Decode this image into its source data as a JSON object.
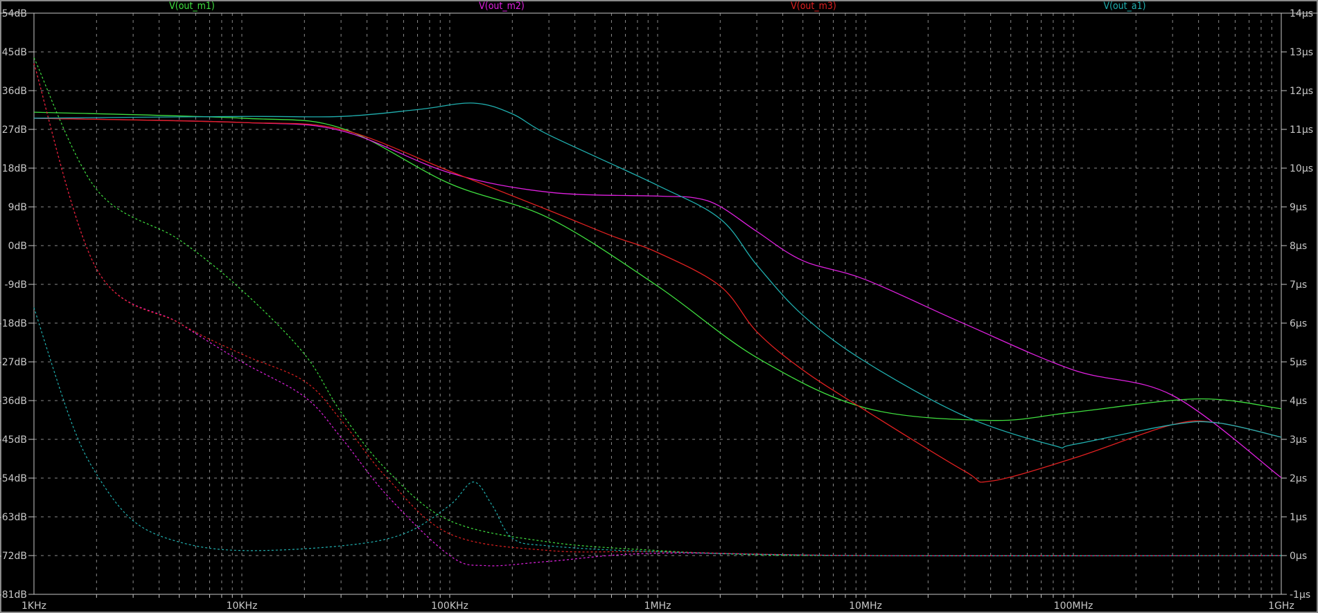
{
  "chart_data": {
    "type": "line",
    "title": "",
    "xscale": "log",
    "xlim": [
      1000,
      1000000000
    ],
    "x_ticks": [
      {
        "value": 1000,
        "label": "1KHz"
      },
      {
        "value": 10000,
        "label": "10KHz"
      },
      {
        "value": 100000,
        "label": "100KHz"
      },
      {
        "value": 1000000,
        "label": "1MHz"
      },
      {
        "value": 10000000,
        "label": "10MHz"
      },
      {
        "value": 100000000,
        "label": "100MHz"
      },
      {
        "value": 1000000000,
        "label": "1GHz"
      }
    ],
    "ylim_left": [
      -81,
      54
    ],
    "left_ticks": [
      "54dB",
      "45dB",
      "36dB",
      "27dB",
      "18dB",
      "9dB",
      "0dB",
      "-9dB",
      "-18dB",
      "-27dB",
      "-36dB",
      "-45dB",
      "-54dB",
      "-63dB",
      "-72dB",
      "-81dB"
    ],
    "ylim_right": [
      -1,
      14
    ],
    "right_ticks": [
      "14µs",
      "13µs",
      "12µs",
      "11µs",
      "10µs",
      "9µs",
      "8µs",
      "7µs",
      "6µs",
      "5µs",
      "4µs",
      "3µs",
      "2µs",
      "1µs",
      "0µs",
      "-1µs"
    ],
    "grid": true,
    "legend_placement": "top",
    "series": [
      {
        "name": "V(out_m1)",
        "color": "#3fe03f",
        "magnitude_db": [
          [
            1000.0,
            31
          ],
          [
            10000.0,
            29.6
          ],
          [
            30000.0,
            27.3
          ],
          [
            100000.0,
            14.4
          ],
          [
            300000.0,
            6.4
          ],
          [
            1000000.0,
            -9.4
          ],
          [
            3000000.0,
            -26
          ],
          [
            10000000.0,
            -37.7
          ],
          [
            40000000.0,
            -40.6
          ],
          [
            100000000.0,
            -38.7
          ],
          [
            400000000.0,
            -35.6
          ],
          [
            1000000000.0,
            -37.9
          ]
        ],
        "group_delay_us": [
          [
            1000.0,
            12.85
          ],
          [
            2000.0,
            9.45
          ],
          [
            5000.0,
            8.15
          ],
          [
            10000.0,
            6.85
          ],
          [
            20000.0,
            5.2
          ],
          [
            30000.0,
            3.7
          ],
          [
            50000.0,
            2.2
          ],
          [
            100000.0,
            0.9
          ],
          [
            300000.0,
            0.35
          ],
          [
            1000000.0,
            0.13
          ],
          [
            3000000.0,
            0.02
          ],
          [
            10000000.0,
            0
          ],
          [
            1000000000.0,
            0
          ]
        ]
      },
      {
        "name": "V(out_m2)",
        "color": "#e020e0",
        "magnitude_db": [
          [
            1000.0,
            29.6
          ],
          [
            10000.0,
            28.6
          ],
          [
            30000.0,
            26.7
          ],
          [
            100000.0,
            16.9
          ],
          [
            300000.0,
            12.4
          ],
          [
            1000000.0,
            11.5
          ],
          [
            1500000.0,
            11.1
          ],
          [
            2000000.0,
            9.1
          ],
          [
            3000000.0,
            3.3
          ],
          [
            5000000.0,
            -3.5
          ],
          [
            10000000.0,
            -7.9
          ],
          [
            30000000.0,
            -18.2
          ],
          [
            100000000.0,
            -28.9
          ],
          [
            300000000.0,
            -34.8
          ],
          [
            1000000000.0,
            -53.9
          ]
        ],
        "group_delay_us": [
          [
            1000.0,
            12.7
          ],
          [
            2000.0,
            7.4
          ],
          [
            5000.0,
            6.0
          ],
          [
            10000.0,
            5.0
          ],
          [
            20000.0,
            4.1
          ],
          [
            30000.0,
            3.05
          ],
          [
            50000.0,
            1.55
          ],
          [
            100000.0,
            0
          ],
          [
            150000.0,
            -0.26
          ],
          [
            300000.0,
            -0.15
          ],
          [
            1000000.0,
            0.06
          ],
          [
            10000000.0,
            0
          ],
          [
            1000000000.0,
            0
          ]
        ]
      },
      {
        "name": "V(out_m3)",
        "color": "#e02020",
        "magnitude_db": [
          [
            1000.0,
            29.6
          ],
          [
            10000.0,
            28.6
          ],
          [
            30000.0,
            27
          ],
          [
            100000.0,
            17.3
          ],
          [
            300000.0,
            8.2
          ],
          [
            600000.0,
            2.3
          ],
          [
            1000000.0,
            -1.6
          ],
          [
            2000000.0,
            -9.4
          ],
          [
            3000000.0,
            -20
          ],
          [
            5000000.0,
            -28.9
          ],
          [
            10000000.0,
            -38.3
          ],
          [
            30000000.0,
            -52.4
          ],
          [
            40000000.0,
            -54.7
          ],
          [
            100000000.0,
            -49.4
          ],
          [
            300000000.0,
            -41.6
          ],
          [
            500000000.0,
            -41.2
          ],
          [
            1000000000.0,
            -44.5
          ]
        ],
        "group_delay_us": [
          [
            1000.0,
            12.7
          ],
          [
            2000.0,
            7.4
          ],
          [
            5000.0,
            6.0
          ],
          [
            10000.0,
            5.2
          ],
          [
            20000.0,
            4.5
          ],
          [
            30000.0,
            3.5
          ],
          [
            50000.0,
            2.0
          ],
          [
            100000.0,
            0.56
          ],
          [
            300000.0,
            0.13
          ],
          [
            1000000.0,
            0.1
          ],
          [
            10000000.0,
            0
          ],
          [
            1000000000.0,
            0
          ]
        ]
      },
      {
        "name": "V(out_a1)",
        "color": "#20b0b0",
        "magnitude_db": [
          [
            1000.0,
            29.6
          ],
          [
            10000.0,
            30
          ],
          [
            30000.0,
            30
          ],
          [
            70000.0,
            31.6
          ],
          [
            130000.0,
            33.1
          ],
          [
            200000.0,
            30.6
          ],
          [
            300000.0,
            25.7
          ],
          [
            1000000.0,
            14
          ],
          [
            2000000.0,
            6.2
          ],
          [
            3000000.0,
            -4.5
          ],
          [
            5000000.0,
            -16.2
          ],
          [
            10000000.0,
            -27
          ],
          [
            30000000.0,
            -39.6
          ],
          [
            80000000.0,
            -46.4
          ],
          [
            100000000.0,
            -46.2
          ],
          [
            300000000.0,
            -41.6
          ],
          [
            500000000.0,
            -41.2
          ],
          [
            1000000000.0,
            -44.5
          ]
        ],
        "group_delay_us": [
          [
            1000.0,
            6.4
          ],
          [
            1500.0,
            3.5
          ],
          [
            2000.0,
            2.1
          ],
          [
            3000.0,
            0.9
          ],
          [
            5000.0,
            0.35
          ],
          [
            10000.0,
            0.13
          ],
          [
            30000.0,
            0.25
          ],
          [
            60000.0,
            0.56
          ],
          [
            100000.0,
            1.3
          ],
          [
            130000.0,
            1.9
          ],
          [
            160000.0,
            1.3
          ],
          [
            200000.0,
            0.45
          ],
          [
            300000.0,
            0.25
          ],
          [
            1000000.0,
            0.1
          ],
          [
            10000000.0,
            0
          ],
          [
            1000000000.0,
            0
          ]
        ]
      }
    ]
  }
}
